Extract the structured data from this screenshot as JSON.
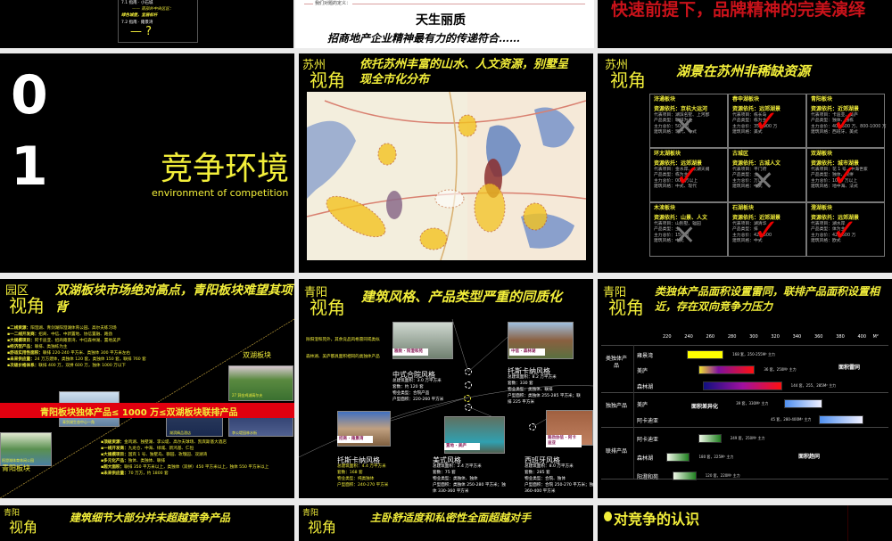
{
  "window": {
    "background": "#ebebeb"
  },
  "row0": {
    "left": {
      "lines": [
        "7.1 指南 · 小石城",
        "—— 南部外中央区区：",
        "绿色城堡，宜居标杆",
        "7.2 指南 · 雍景湾",
        "— ?"
      ]
    },
    "middle": {
      "definition_label": "我们对题的定义：",
      "title": "天生丽质",
      "subtitle": "招商地产企业精神最有力的传递符合……"
    },
    "right": {
      "text": "快速前提下，品牌精神的完美演绎",
      "color": "#c8121a"
    }
  },
  "row1": {
    "section": {
      "digit1": "0",
      "digit2": "1",
      "title": "竞争环境",
      "subtitle": "environment of competition"
    },
    "map_slide": {
      "tag1": "苏州",
      "tag2": "视角",
      "title": "依托苏州丰富的山水、人文资源，别墅呈现全市化分布"
    },
    "table_slide": {
      "tag1": "苏州",
      "tag2": "视角",
      "title": "湖景在苏州非稀缺资源",
      "cells": [
        {
          "name": "浒通板块",
          "resource": "资源依托：京杭大运河",
          "details": [
            "代表项目：湖滨名墅、上河郡",
            "产品类型：联排为主",
            "主力总价：500 万",
            "建筑风格：现代、中式"
          ],
          "mark": "cross"
        },
        {
          "name": "春申湖板块",
          "resource": "资源依托：远郊湖景",
          "details": [
            "代表项目：栋长岛",
            "产品类型：栋为主",
            "主力总价：350-900 万",
            "建筑风格：美式"
          ],
          "mark": "check"
        },
        {
          "name": "青阳板块",
          "resource": "资源依托：近郊湖景",
          "details": [
            "代表项目：卡迪亚、美庐",
            "产品类型：独体、独栋",
            "主力总价：400-500 万、800-1000 万",
            "建筑风格：西班牙、美式"
          ],
          "mark": "check"
        },
        {
          "name": "环太湖板块",
          "resource": "资源依托：远郊湖景",
          "details": [
            "代表项目：金水岸、太湖天阙",
            "产品类型：栋为主",
            "主力总价：000 万以上",
            "建筑风格：中式、现代"
          ],
          "mark": "check"
        },
        {
          "name": "古城区",
          "resource": "资源依托：古城人文",
          "details": [
            "代表项目：平门府",
            "产品类型：主",
            "主力总价：万以上",
            "建筑风格：中式"
          ],
          "mark": "cross"
        },
        {
          "name": "双湖板块",
          "resource": "资源依托：城市湖景",
          "details": [
            "代表项目：花 1 号、中海世家",
            "产品类型：独体、双拼",
            "主力总价：1000 万以上",
            "建筑风格：地中海、法式"
          ],
          "mark": "check"
        },
        {
          "name": "木渎板块",
          "resource": "资源依托：山景、人文",
          "details": [
            "代表项目：山别墅、辐园",
            "产品类型：主",
            "主力总价：150 万",
            "建筑风格：中式"
          ],
          "mark": "cross"
        },
        {
          "name": "石湖板块",
          "resource": "资源依托：近郊湖景",
          "details": [
            "代表项目：湖清华",
            "产品类型：排",
            "主力总价：420-500",
            "建筑风格：中式"
          ],
          "mark": "check"
        },
        {
          "name": "澄湖板块",
          "resource": "资源依托：远郊湖景",
          "details": [
            "代表项目：湖水岸",
            "产品类型：体为主",
            "主力总价：420-600 万",
            "建筑风格：欧式"
          ],
          "mark": "check"
        }
      ]
    }
  },
  "row2": {
    "park_slide": {
      "tag1": "园区",
      "tag2": "视角",
      "title": "双湖板块市场绝对高点，青阳板块难望其项背",
      "top_bullets": [
        {
          "k": "二线资源：",
          "v": "阳澄湖、青剑湖阳澄湖体育公园、高尔夫练习场"
        },
        {
          "k": "一二线开发商：",
          "v": "招商、中信、中新置地、协信置融、路劲"
        },
        {
          "k": "大规模项目：",
          "v": "阿卡迪亚、招商雍景湾、中信森林湖、置地美庐"
        },
        {
          "k": "经济型产品：",
          "v": "联排、类独栋为主"
        },
        {
          "k": "舒适实用性面积：",
          "v": "联排 220-240 平方米、类独体 300 平方米左右"
        },
        {
          "k": "未来供应量：",
          "v": "24 万方建体，类独体 120 套，类独体 150 套，联排 760 套"
        },
        {
          "k": "次级价格体系：",
          "v": "联排 400 万，双拼 600 万，独体 1000 万以下"
        }
      ],
      "shuanghu_label": "双湖板块",
      "qingyang_label": "青阳板块",
      "banner": "青阳板块独体产品≤ 1000 万≤双湖板块联排产品",
      "banner_color": "#e0000f",
      "photo_captions": [
        "27 洞金鸡湖高尔夫",
        "青剑湖生态中心一角",
        "湖滨精品酒店",
        "李公堤园林水街",
        "阳澄湖体育休闲公园"
      ],
      "bottom_bullets": [
        {
          "k": "顶级资源：",
          "v": "金鸡湖、独墅湖、李公堤、高尔夫球场、凯宾斯基大酒店"
        },
        {
          "k": "一线开发商：",
          "v": "九龙仓、中海、绿城、新鸿基、仁恒"
        },
        {
          "k": "大规模项目：",
          "v": "国宾 1 号、独墅岛、御园、玫瑰园、双湖湾"
        },
        {
          "k": "多元化产品：",
          "v": "独体、类独体、联排"
        },
        {
          "k": "超大面积：",
          "v": "联排 350 平方米以上，类独体（双拼）450 平方米以上，独体 550 平方米以上"
        },
        {
          "k": "未来供应量：",
          "v": "70 万方，约 1800 套"
        }
      ]
    },
    "style_slide": {
      "tag1": "青阳",
      "tag2": "视角",
      "title": "建筑风格、产品类型严重的同质化",
      "notes": [
        "除阳澄和苑外，其余竞品风格雷同或类似",
        "森林湖、美庐都具面积相同的类独体产品"
      ],
      "projects": [
        {
          "label": "雅致 · 阳澄和苑",
          "style": "中式合院风格",
          "info": [
            "总建筑面积：3.0 万平方米",
            "套数：约 120 套",
            "物业类型：合院产品",
            "户型面积：220-260 平方米"
          ]
        },
        {
          "label": "中信 · 森林湖",
          "style": "托斯卡纳风格",
          "info": [
            "总建筑面积：8.2 万平方米",
            "套数：330 套",
            "物业类型：类独体、联排",
            "户型面积：类独体 255-285 平方米；联排 225 平方米"
          ]
        },
        {
          "label": "招商 · 雍景湾",
          "style": "托斯卡纳风格",
          "info": [
            "总建筑面积：4.4 万平方米",
            "套数：168 套",
            "物业类型：纯类独体",
            "户型面积：240-270 平方米"
          ]
        },
        {
          "label": "置地 · 美庐",
          "style": "美式风格",
          "info": [
            "总建筑面积：2.4 万平方米",
            "套数：75 套",
            "物业类型：类独体、独体",
            "户型面积：类独体 250-280 平方米；独体 330-360 平方米"
          ]
        },
        {
          "label": "路劲协信 · 阿卡迪亚",
          "style": "西班牙风格",
          "info": [
            "总建筑面积：8.0 万平方米",
            "套数：285 套",
            "物业类型：合院、独体",
            "户型面积：合院 250-270 平方米；独体 360-400 平方米"
          ]
        }
      ]
    },
    "area_slide": {
      "tag1": "青阳",
      "tag2": "视角",
      "title": "类独体产品面积设置雷同，联排产品面积设置相近，存在双向竞争力压力",
      "axis_ticks": [
        220,
        240,
        260,
        280,
        300,
        320,
        340,
        360,
        380,
        400
      ],
      "axis_unit": "M²",
      "groups": [
        {
          "name": "类独体产品",
          "note": "面积雷同"
        },
        {
          "name": "独独产品",
          "note": "面积差异化"
        },
        {
          "name": "联排产品",
          "note": "面积趋同"
        }
      ],
      "bars": [
        {
          "project": "雍景湾",
          "group": 0,
          "from": 238,
          "to": 272,
          "label": "168 套，250-255M² 主力",
          "fill": "linear-gradient(90deg,#ffff00,#ffff00)"
        },
        {
          "project": "美庐",
          "group": 0,
          "from": 249,
          "to": 301,
          "label": "36 套，250M² 主力",
          "fill": "linear-gradient(90deg,#f0e030,#8010a0 35%,#ff1010)"
        },
        {
          "project": "森林湖",
          "group": 0,
          "from": 253,
          "to": 326,
          "label": "144 套，255、285M² 主力",
          "fill": "linear-gradient(90deg,#101080,#a010a0 50%,#ff1010)"
        },
        {
          "project": "美庐",
          "group": 1,
          "from": 328,
          "to": 363,
          "label": "39 套，330M² 主力",
          "fill": "linear-gradient(90deg,#5090f0,#f0f0ff)"
        },
        {
          "project": "阿卡迪亚",
          "group": 1,
          "from": 360,
          "to": 401,
          "label": "45 套，280-400M² 主力",
          "fill": "linear-gradient(90deg,#5090f0,#f0f0ff)"
        },
        {
          "project": "阿卡迪亚",
          "group": 2,
          "from": 249,
          "to": 270,
          "label": "249 套，250M² 主力",
          "fill": "linear-gradient(90deg,#f0f8e8,#208020)"
        },
        {
          "project": "森林湖",
          "group": 2,
          "from": 219,
          "to": 241,
          "label": "180 套，225M² 主力",
          "fill": "linear-gradient(90deg,#f0f8e8,#208020)"
        },
        {
          "project": "阳澄和苑",
          "group": 2,
          "from": 225,
          "to": 247,
          "label": "120 套，220M² 主力",
          "fill": "linear-gradient(90deg,#f0f8e8,#208020)"
        }
      ]
    }
  },
  "row3": {
    "left": {
      "tag1": "青阳",
      "tag2": "视角",
      "title": "建筑细节大部分并未超越竞争产品"
    },
    "middle": {
      "tag1": "青阳",
      "tag2": "视角",
      "title": "主卧舒适度和私密性全面超越对手"
    },
    "right": {
      "title": "对竞争的认识"
    }
  }
}
